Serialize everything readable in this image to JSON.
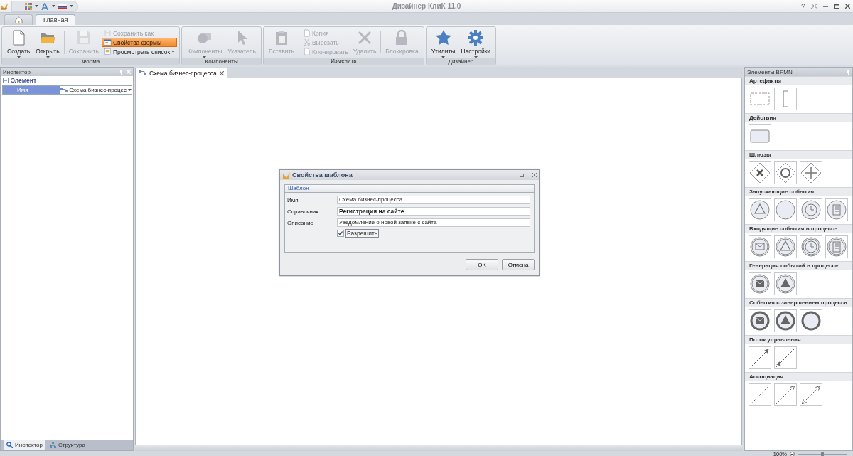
{
  "window": {
    "title": "Дизайнер КлиК 11.0"
  },
  "ribbon_tabs": [
    {
      "kind": "home",
      "selected": false
    },
    {
      "kind": "text",
      "label": "Главная",
      "selected": true
    }
  ],
  "ribbon_groups": [
    {
      "title": "Форма",
      "items": [
        {
          "kind": "large",
          "label": "Создать",
          "disabled": false,
          "dropdown": true
        },
        {
          "kind": "large",
          "label": "Открыть",
          "disabled": false,
          "dropdown": true
        },
        {
          "kind": "separator"
        },
        {
          "kind": "large",
          "label": "Сохранить",
          "disabled": true,
          "dropdown": false
        },
        {
          "kind": "stack",
          "items": [
            {
              "label": "Сохранить как",
              "disabled": true,
              "highlighted": false,
              "dropdown": false
            },
            {
              "label": "Свойства формы",
              "disabled": false,
              "highlighted": true,
              "dropdown": false
            },
            {
              "label": "Просмотреть список",
              "disabled": false,
              "highlighted": false,
              "dropdown": true
            }
          ]
        }
      ]
    },
    {
      "title": "Компоненты",
      "items": [
        {
          "kind": "large",
          "label": "Компоненты",
          "disabled": true,
          "dropdown": true
        },
        {
          "kind": "large",
          "label": "Указатель",
          "disabled": true,
          "dropdown": false
        }
      ]
    },
    {
      "title": "Изменить",
      "items": [
        {
          "kind": "large",
          "label": "Вставить",
          "disabled": true,
          "dropdown": false
        },
        {
          "kind": "separator"
        },
        {
          "kind": "stack",
          "items": [
            {
              "label": "Копия",
              "disabled": true,
              "highlighted": false,
              "dropdown": false
            },
            {
              "label": "Вырезать",
              "disabled": true,
              "highlighted": false,
              "dropdown": false
            },
            {
              "label": "Клонировать",
              "disabled": true,
              "highlighted": false,
              "dropdown": false
            }
          ]
        },
        {
          "kind": "large",
          "label": "Удалить",
          "disabled": true,
          "dropdown": false
        },
        {
          "kind": "separator"
        },
        {
          "kind": "large",
          "label": "Блокировка",
          "disabled": true,
          "dropdown": false
        }
      ]
    },
    {
      "title": "Дизайнер",
      "items": [
        {
          "kind": "large",
          "label": "Утилиты",
          "disabled": false,
          "dropdown": true
        },
        {
          "kind": "large",
          "label": "Настройки",
          "disabled": false,
          "dropdown": true
        }
      ]
    }
  ],
  "inspector": {
    "title": "Инспектор",
    "group": {
      "label": "Элемент",
      "expanded": true,
      "rows": [
        {
          "name": "Имя",
          "value": "Схема бизнес-процес",
          "selected": true
        }
      ]
    },
    "bottom_tabs": [
      {
        "label": "Инспектор",
        "selected": true
      },
      {
        "label": "Структура",
        "selected": false
      }
    ]
  },
  "document_tabs": [
    {
      "label": "Схема бизнес-процесса",
      "selected": true
    }
  ],
  "dialog": {
    "title": "Свойства шаблона",
    "group": "Шаблон",
    "fields": [
      {
        "label": "Имя",
        "value": "Схема бизнес-процесса",
        "bold": false
      },
      {
        "label": "Справочник",
        "value": "Регистрация на сайте",
        "bold": true
      },
      {
        "label": "Описание",
        "value": "Уведомление о новой заявке с сайта",
        "bold": false
      }
    ],
    "checkbox": {
      "label": "Разрешить",
      "checked": true
    },
    "buttons": [
      "OK",
      "Отмена"
    ]
  },
  "palette": {
    "title": "Элементы BPMN",
    "sections": [
      {
        "title": "Артефакты",
        "items": [
          {
            "kind": "group"
          },
          {
            "kind": "annotation"
          }
        ]
      },
      {
        "title": "Действия",
        "items": [
          {
            "kind": "task"
          }
        ]
      },
      {
        "title": "Шлюзы",
        "items": [
          {
            "kind": "gateway-x"
          },
          {
            "kind": "gateway-o"
          },
          {
            "kind": "gateway-plus"
          }
        ]
      },
      {
        "title": "Запускающие события",
        "items": [
          {
            "kind": "start-signal"
          },
          {
            "kind": "start-none"
          },
          {
            "kind": "start-timer"
          },
          {
            "kind": "start-conditional"
          }
        ]
      },
      {
        "title": "Входящие события в процессе",
        "items": [
          {
            "kind": "catch-message"
          },
          {
            "kind": "catch-signal"
          },
          {
            "kind": "catch-timer"
          },
          {
            "kind": "catch-conditional"
          }
        ]
      },
      {
        "title": "Генерация событий в процессе",
        "items": [
          {
            "kind": "throw-message"
          },
          {
            "kind": "throw-signal"
          }
        ]
      },
      {
        "title": "События с завершением процесса",
        "items": [
          {
            "kind": "end-message"
          },
          {
            "kind": "end-signal"
          },
          {
            "kind": "end-none"
          }
        ]
      },
      {
        "title": "Поток управления",
        "items": [
          {
            "kind": "flow"
          },
          {
            "kind": "flow-default"
          }
        ]
      },
      {
        "title": "Ассоциация",
        "items": [
          {
            "kind": "assoc-line"
          },
          {
            "kind": "assoc-arrow"
          },
          {
            "kind": "assoc-both"
          }
        ]
      }
    ]
  },
  "status_bar": {
    "zoom": "100%",
    "zoom_slider": {
      "level": 0.5
    }
  }
}
